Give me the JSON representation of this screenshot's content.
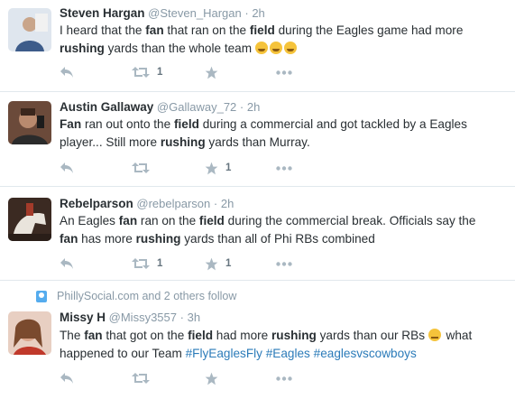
{
  "tweets": [
    {
      "name": "Steven Hargan",
      "handle": "@Steven_Hargan",
      "dot": "·",
      "time": "2h",
      "text": {
        "l1a": "I heard that the ",
        "l1b": "fan",
        "l1c": " that ran on the ",
        "l1d": "field",
        "l1e": " during the Eagles game had more",
        "l2a": "rushing",
        "l2b": " yards than the whole team "
      },
      "retweets": "1",
      "favorites": ""
    },
    {
      "name": "Austin Gallaway",
      "handle": "@Gallaway_72",
      "dot": "·",
      "time": "2h",
      "text": {
        "l1a": "Fan",
        "l1b": " ran out onto the ",
        "l1c": "field",
        "l1d": " during a commercial and got tackled by a Eagles",
        "l2a": "player... Still more ",
        "l2b": "rushing",
        "l2c": " yards than Murray."
      },
      "retweets": "",
      "favorites": "1"
    },
    {
      "name": "Rebelparson",
      "handle": "@rebelparson",
      "dot": "·",
      "time": "2h",
      "text": {
        "l1a": "An Eagles ",
        "l1b": "fan",
        "l1c": " ran on the ",
        "l1d": "field",
        "l1e": " during the commercial break. Officials say the",
        "l2a": "fan",
        "l2b": " has more ",
        "l2c": "rushing",
        "l2d": " yards than all of Phi RBs combined"
      },
      "retweets": "1",
      "favorites": "1"
    },
    {
      "context": "PhillySocial.com and 2 others follow",
      "name": "Missy H",
      "handle": "@Missy3557",
      "dot": "·",
      "time": "3h",
      "text": {
        "l1a": "The ",
        "l1b": "fan",
        "l1c": " that got on the ",
        "l1d": "field",
        "l1e": " had more ",
        "l1f": "rushing",
        "l1g": " yards than our RBs ",
        "l1h": " what",
        "l2a": "happened to our Team ",
        "l2b": "#FlyEaglesFly",
        "l2c": " ",
        "l2d": "#Eagles",
        "l2e": " ",
        "l2f": "#eaglesvscowboys"
      },
      "retweets": "",
      "favorites": ""
    }
  ],
  "icons": {
    "reply": "reply-icon",
    "retweet": "retweet-icon",
    "favorite": "star-icon",
    "more": "more-icon",
    "context": "follow-context-icon"
  },
  "colors": {
    "link": "#2b7bb9",
    "muted": "#8899a6",
    "icon": "#aab8c2",
    "divider": "#e1e8ed"
  }
}
